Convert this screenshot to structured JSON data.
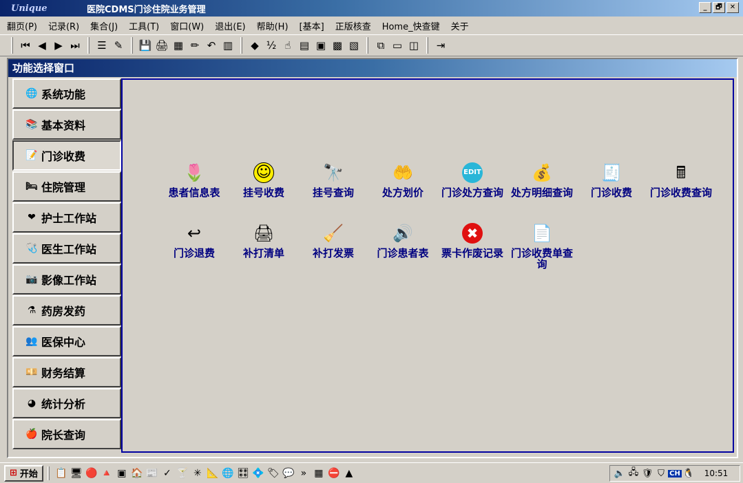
{
  "window": {
    "logo": "Unique",
    "title": "医院CDMS门诊住院业务管理",
    "controls": [
      "_",
      "🗗",
      "✕"
    ]
  },
  "menu": [
    "翻页(P)",
    "记录(R)",
    "集合(J)",
    "工具(T)",
    "窗口(W)",
    "退出(E)",
    "帮助(H)",
    "[基本]",
    "正版核查",
    "Home_快查键",
    "关于"
  ],
  "toolbar_icons": [
    "first-icon",
    "prev-icon",
    "next-icon",
    "last-icon",
    "|",
    "list-icon",
    "brush-icon",
    "|",
    "save-icon",
    "print-icon",
    "grid-icon",
    "edit-icon",
    "undo-icon",
    "chart-icon",
    "|",
    "gem-icon",
    "percent-icon",
    "hand-icon",
    "table-icon",
    "panel-icon",
    "photo-icon",
    "report-icon",
    "|",
    "tile-icon",
    "window-icon",
    "columns-icon",
    "|",
    "exit-icon"
  ],
  "frame": {
    "title": "功能选择窗口"
  },
  "sidebar": [
    {
      "label": "系统功能",
      "icon": "globe-icon",
      "glyph": "🌐"
    },
    {
      "label": "基本资料",
      "icon": "papers-icon",
      "glyph": "📚"
    },
    {
      "label": "门诊收费",
      "icon": "register-icon",
      "glyph": "📝",
      "active": true
    },
    {
      "label": "住院管理",
      "icon": "bed-icon",
      "glyph": "🛏"
    },
    {
      "label": "护士工作站",
      "icon": "heart-icon",
      "glyph": "❤"
    },
    {
      "label": "医生工作站",
      "icon": "doctor-icon",
      "glyph": "🩺"
    },
    {
      "label": "影像工作站",
      "icon": "camera-icon",
      "glyph": "📷"
    },
    {
      "label": "药房发药",
      "icon": "flask-icon",
      "glyph": "⚗"
    },
    {
      "label": "医保中心",
      "icon": "people-icon",
      "glyph": "👥"
    },
    {
      "label": "财务结算",
      "icon": "money-icon",
      "glyph": "💴"
    },
    {
      "label": "统计分析",
      "icon": "pie-chart-icon",
      "glyph": "◕"
    },
    {
      "label": "院长查询",
      "icon": "apple-icon",
      "glyph": "🍎"
    }
  ],
  "functions": [
    {
      "label": "患者信息表",
      "icon": "flowers-icon",
      "glyph": "🌷"
    },
    {
      "label": "挂号收费",
      "icon": "smiley-icon",
      "glyph": "☺"
    },
    {
      "label": "挂号查询",
      "icon": "binoculars-icon",
      "glyph": "🔭"
    },
    {
      "label": "处方划价",
      "icon": "hand-money-icon",
      "glyph": "🤲"
    },
    {
      "label": "门诊处方查询",
      "icon": "edit-badge-icon",
      "glyph": "EDIT"
    },
    {
      "label": "处方明细查询",
      "icon": "money-bag-icon",
      "glyph": "💰"
    },
    {
      "label": "门诊收费",
      "icon": "receipt-icon",
      "glyph": "🧾"
    },
    {
      "label": "门诊收费查询",
      "icon": "calculator-icon",
      "glyph": "🖩"
    },
    {
      "label": "门诊退费",
      "icon": "refund-icon",
      "glyph": "↩"
    },
    {
      "label": "补打清单",
      "icon": "printer-list-icon",
      "glyph": "🖨"
    },
    {
      "label": "补打发票",
      "icon": "broom-icon",
      "glyph": "🧹"
    },
    {
      "label": "门诊患者表",
      "icon": "speaker-icon",
      "glyph": "🔊"
    },
    {
      "label": "票卡作废记录",
      "icon": "cancel-icon",
      "glyph": "✖"
    },
    {
      "label": "门诊收费单查询",
      "icon": "document-arrow-icon",
      "glyph": "📄"
    }
  ],
  "taskbar": {
    "start": "开始",
    "clock": "10:51",
    "tray_ch": "CH"
  }
}
